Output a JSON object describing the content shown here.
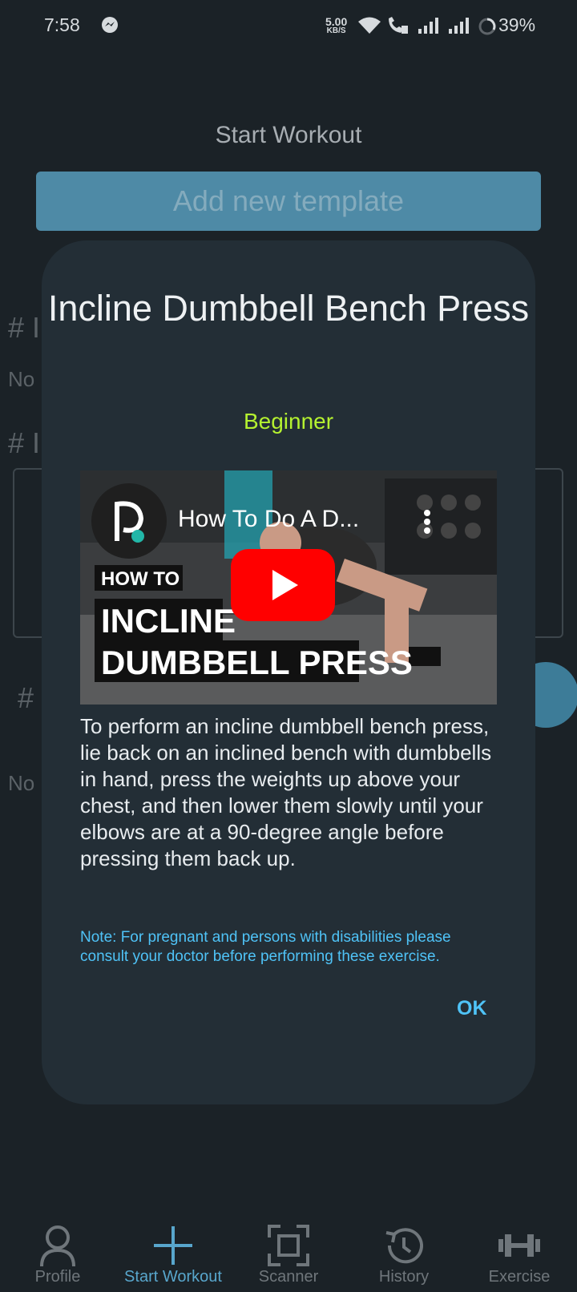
{
  "status_bar": {
    "time": "7:58",
    "speed_value": "5.00",
    "speed_unit": "KB/S",
    "battery": "39%"
  },
  "page": {
    "title": "Start Workout",
    "add_template_label": "Add new template"
  },
  "background": {
    "hash": "# I",
    "no_text": "No"
  },
  "dialog": {
    "title": "Incline Dumbbell Bench Press",
    "level": "Beginner",
    "video": {
      "title": "How To Do A D...",
      "overlay_small": "HOW TO",
      "overlay_line1": "INCLINE",
      "overlay_line2": "DUMBBELL PRESS"
    },
    "description": "To perform an incline dumbbell bench press, lie back on an inclined bench with dumbbells in hand, press the weights up above your chest, and then lower them slowly until your elbows are at a 90-degree angle before pressing them back up.",
    "note": "Note: For pregnant and persons with disabilities please consult your doctor before performing these exercise.",
    "ok_label": "OK"
  },
  "nav": [
    {
      "label": "Profile",
      "icon": "person-icon"
    },
    {
      "label": "Start Workout",
      "icon": "plus-icon",
      "active": true
    },
    {
      "label": "Scanner",
      "icon": "scan-icon"
    },
    {
      "label": "History",
      "icon": "history-icon"
    },
    {
      "label": "Exercise",
      "icon": "dumbbell-icon"
    }
  ],
  "colors": {
    "background": "#1b2227",
    "dialog": "#232e36",
    "accent": "#58a6cc",
    "level": "#b5f230",
    "note": "#4fc3f7"
  }
}
